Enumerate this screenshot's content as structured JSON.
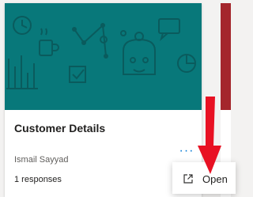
{
  "card": {
    "title": "Customer Details",
    "author": "Ismail Sayyad",
    "responses": "1 responses",
    "more_icon": "ellipsis-icon",
    "banner_color": "#08787a"
  },
  "context_menu": {
    "items": [
      {
        "label": "Open",
        "icon": "open-in-new-window-icon"
      }
    ]
  },
  "annotation": {
    "arrow_color": "#e81123"
  }
}
